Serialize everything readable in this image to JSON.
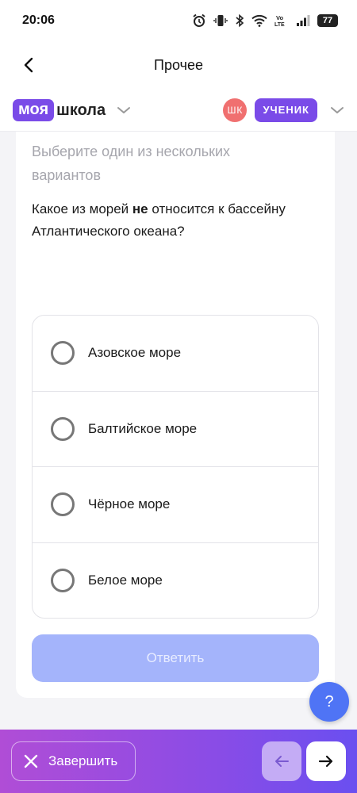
{
  "status": {
    "time": "20:06",
    "icons": [
      "alarm-icon",
      "vibrate-icon",
      "bluetooth-icon",
      "wifi-icon",
      "volte-icon",
      "signal-icon",
      "battery-icon"
    ],
    "volte_top": "Vo",
    "volte_bottom": "LTE",
    "battery": "77"
  },
  "nav": {
    "title": "Прочее",
    "back_icon": "chevron-left-icon"
  },
  "brand": {
    "logo_part1": "моя",
    "logo_part2": "школа",
    "avatar_initials": "ШК",
    "role": "УЧЕНИК",
    "colors": {
      "brand": "#7a4be8",
      "avatar": "#f07070"
    }
  },
  "question": {
    "instruction": "Выберите один из нескольких вариантов",
    "text_before": "Какое из морей ",
    "text_emphasis": "не",
    "text_after": " относится к бассейну Атлантического океана?",
    "options": [
      {
        "label": "Азовское море"
      },
      {
        "label": "Балтийское море"
      },
      {
        "label": "Чёрное море"
      },
      {
        "label": "Белое море"
      }
    ],
    "submit_label": "Ответить"
  },
  "help": {
    "label": "?"
  },
  "bottom": {
    "finish_label": "Завершить",
    "prev_icon": "arrow-left-icon",
    "next_icon": "arrow-right-icon"
  }
}
